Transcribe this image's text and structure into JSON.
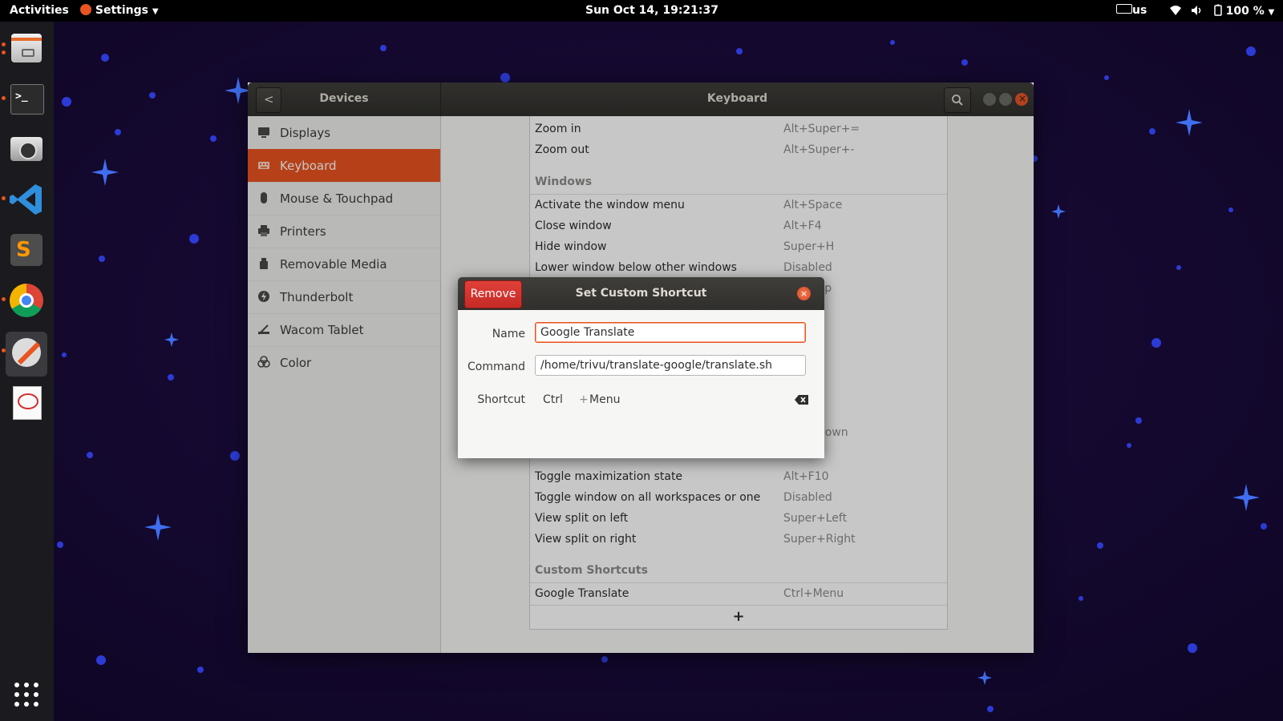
{
  "topbar": {
    "activities": "Activities",
    "app_menu": "Settings",
    "clock": "Sun Oct 14, 19:21:37",
    "keyboard_layout": "us",
    "battery": "100 %"
  },
  "dock": {
    "items": [
      {
        "name": "files-icon"
      },
      {
        "name": "terminal-icon"
      },
      {
        "name": "camera-icon"
      },
      {
        "name": "vscode-icon"
      },
      {
        "name": "sublime-text-icon"
      },
      {
        "name": "chrome-icon"
      },
      {
        "name": "settings-tools-icon"
      },
      {
        "name": "document-viewer-icon"
      }
    ],
    "app_grid": "show-applications-icon"
  },
  "window": {
    "header_left": "Devices",
    "header_title": "Keyboard",
    "sidebar": [
      {
        "label": "Displays",
        "icon": "display-icon"
      },
      {
        "label": "Keyboard",
        "icon": "keyboard-icon"
      },
      {
        "label": "Mouse & Touchpad",
        "icon": "mouse-icon"
      },
      {
        "label": "Printers",
        "icon": "printer-icon"
      },
      {
        "label": "Removable Media",
        "icon": "usb-icon"
      },
      {
        "label": "Thunderbolt",
        "icon": "thunderbolt-icon"
      },
      {
        "label": "Wacom Tablet",
        "icon": "tablet-icon"
      },
      {
        "label": "Color",
        "icon": "color-icon"
      }
    ],
    "shortcuts": {
      "top_rows": [
        {
          "name": "Zoom in",
          "accel": "Alt+Super+="
        },
        {
          "name": "Zoom out",
          "accel": "Alt+Super+-"
        }
      ],
      "windows_title": "Windows",
      "windows_rows": [
        {
          "name": "Activate the window menu",
          "accel": "Alt+Space"
        },
        {
          "name": "Close window",
          "accel": "Alt+F4"
        },
        {
          "name": "Hide window",
          "accel": "Super+H"
        },
        {
          "name": "Lower window below other windows",
          "accel": "Disabled"
        }
      ],
      "hidden_accels": [
        "Up",
        "d",
        "d",
        "d",
        "d",
        "Down",
        "d"
      ],
      "bottom_rows": [
        {
          "name": "Toggle maximization state",
          "accel": "Alt+F10"
        },
        {
          "name": "Toggle window on all workspaces or one",
          "accel": "Disabled"
        },
        {
          "name": "View split on left",
          "accel": "Super+Left"
        },
        {
          "name": "View split on right",
          "accel": "Super+Right"
        }
      ],
      "custom_title": "Custom Shortcuts",
      "custom_rows": [
        {
          "name": "Google Translate",
          "accel": "Ctrl+Menu"
        }
      ],
      "add_label": "+"
    }
  },
  "dialog": {
    "remove_label": "Remove",
    "title": "Set Custom Shortcut",
    "name_label": "Name",
    "name_value": "Google Translate",
    "command_label": "Command",
    "command_value": "/home/trivu/translate-google/translate.sh",
    "shortcut_label": "Shortcut",
    "shortcut_key1": "Ctrl",
    "shortcut_plus": "+",
    "shortcut_key2": "Menu"
  }
}
